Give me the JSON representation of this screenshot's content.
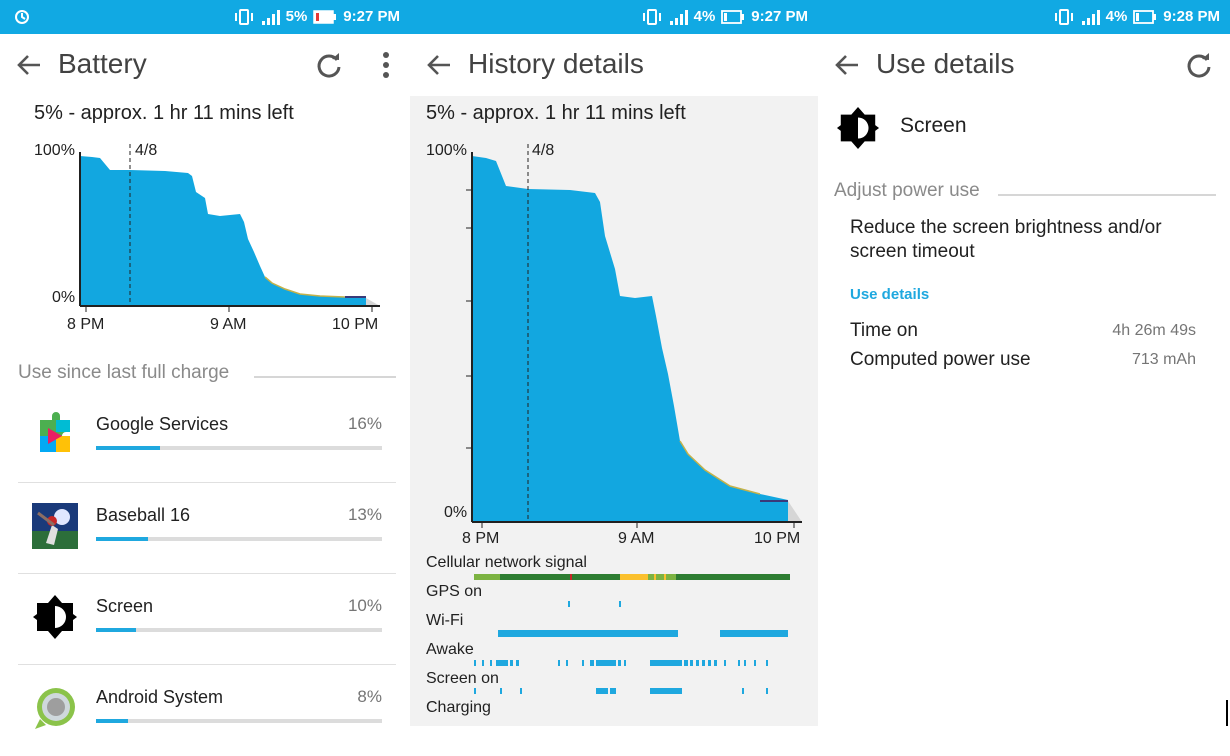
{
  "colors": {
    "statusbar": "#11a9e3",
    "accent": "#1fa8df",
    "chart_fill": "#12a7e0",
    "signal_good": "#2e7d32",
    "signal_mid": "#7cb342",
    "signal_weak": "#fbc02d"
  },
  "panels": [
    {
      "status": {
        "battery_pct": "5%",
        "time": "9:27 PM",
        "left_icon": "circle-sync-icon",
        "battery_icon": "battery-low-red-icon"
      },
      "toolbar": {
        "title": "Battery",
        "back_icon": "back-arrow-icon",
        "refresh_icon": "refresh-icon",
        "more_icon": "overflow-menu-icon"
      },
      "summary": "5% - approx. 1 hr 11 mins left",
      "chart": {
        "y_top": "100%",
        "y_bottom": "0%",
        "marker": "4/8",
        "x_ticks": [
          "8 PM",
          "9 AM",
          "10 PM"
        ]
      },
      "section_title": "Use since last full charge",
      "apps": [
        {
          "name": "Google Services",
          "pct": "16%",
          "fraction": 0.16,
          "icon": "google-play-services-icon"
        },
        {
          "name": "Baseball 16",
          "pct": "13%",
          "fraction": 0.13,
          "icon": "baseball-game-icon"
        },
        {
          "name": "Screen",
          "pct": "10%",
          "fraction": 0.1,
          "icon": "brightness-icon"
        },
        {
          "name": "Android System",
          "pct": "8%",
          "fraction": 0.08,
          "icon": "android-system-icon"
        }
      ]
    },
    {
      "status": {
        "battery_pct": "4%",
        "time": "9:27 PM",
        "battery_icon": "battery-low-icon"
      },
      "toolbar": {
        "title": "History details",
        "back_icon": "back-arrow-icon"
      },
      "summary": "5% - approx. 1 hr 11 mins left",
      "chart": {
        "y_top": "100%",
        "y_bottom": "0%",
        "marker": "4/8",
        "x_ticks": [
          "8 PM",
          "9 AM",
          "10 PM"
        ]
      },
      "timelines": [
        {
          "label": "Cellular network signal"
        },
        {
          "label": "GPS on"
        },
        {
          "label": "Wi-Fi"
        },
        {
          "label": "Awake"
        },
        {
          "label": "Screen on"
        },
        {
          "label": "Charging"
        }
      ]
    },
    {
      "status": {
        "battery_pct": "4%",
        "time": "9:28 PM",
        "battery_icon": "battery-low-icon"
      },
      "toolbar": {
        "title": "Use details",
        "back_icon": "back-arrow-icon",
        "refresh_icon": "refresh-icon"
      },
      "item": {
        "name": "Screen",
        "icon": "brightness-icon"
      },
      "section_title": "Adjust power use",
      "tip": "Reduce the screen brightness and/or screen timeout",
      "link": "Use details",
      "rows": [
        {
          "label": "Time on",
          "value": "4h 26m 49s"
        },
        {
          "label": "Computed power use",
          "value": "713 mAh"
        }
      ]
    }
  ]
}
